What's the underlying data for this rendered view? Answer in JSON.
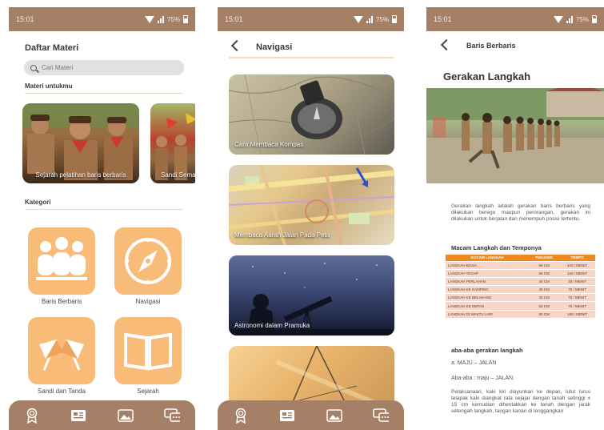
{
  "colors": {
    "statusbar": "#a57f66",
    "accent_tile": "#f8bc78",
    "table_header": "#f1891f",
    "table_row": "#f7d5c7"
  },
  "status": {
    "time": "15:01",
    "battery": "75%"
  },
  "screen1": {
    "title": "Daftar Materi",
    "search_placeholder": "Cari Materi",
    "section_recommended": "Materi untukmu",
    "cards": [
      {
        "label": "Sejarah pelatihan baris berbaris"
      },
      {
        "label": "Sandi Semap"
      }
    ],
    "section_category": "Kategori",
    "categories": [
      {
        "label": "Baris Berbaris",
        "icon": "people-group-icon"
      },
      {
        "label": "Navigasi",
        "icon": "compass-icon"
      },
      {
        "label": "Sandi dan Tanda",
        "icon": "semaphore-flags-icon"
      },
      {
        "label": "Sejarah",
        "icon": "open-book-icon"
      }
    ]
  },
  "screen2": {
    "title": "Navigasi",
    "cards": [
      {
        "label": "Cara Membaca Kompas"
      },
      {
        "label": "Membaca Aarah Jalan Pada Peta"
      },
      {
        "label": "Astronomi dalam Pramuka"
      },
      {
        "label": ""
      }
    ]
  },
  "screen3": {
    "title": "Baris Berbaris",
    "heading": "Gerakan Langkah",
    "intro": "Gerakan langkah adalah gerakan baris berbaris yang dilakukan beregu maupun perorangan, gerakan ini dilakukan untuk berjalan dan menempuh posisi tertentu.",
    "table_title": "Macam Langkah dan Temponya",
    "table": {
      "headers": [
        "MACAM LANGKAH",
        "PANJANG",
        "TEMPO"
      ],
      "rows": [
        [
          "LANGKAH BIASA",
          "65 CM",
          "120 / MENIT"
        ],
        [
          "LANGKAH TEGAP",
          "65 CM",
          "120 / MENIT"
        ],
        [
          "LANGKAH PERLAHAN",
          "40 CM",
          "30 / MENIT"
        ],
        [
          "LANGKAH KE SAMPING",
          "40 CM",
          "70 / MENIT"
        ],
        [
          "LANGKAH KE BELAKANG",
          "40 CM",
          "70 / MENIT"
        ],
        [
          "LANGKAH KE DEPAN",
          "60 CM",
          "70 / MENIT"
        ],
        [
          "LANGKAH DI WAKTU LARI",
          "80 CM",
          "165 / MENIT"
        ]
      ]
    },
    "command_title": "aba-aba gerakan langkah",
    "command_1": "a. MAJU – JALAN",
    "command_2": "Aba-aba : maju – JALAN.",
    "execution": "Pelaksanaan, kaki kiri diayunkan ke depan, lutut lurus telapak kaki diangkat rata sejajar dengan tanah setinggi ± 15 cm kemudian dihentakkan ke tanah dengan jarak setengah langkah, tangan kanan di lenggangkan"
  },
  "bottom_nav": [
    "award-badge-icon",
    "news-card-icon",
    "gallery-image-icon",
    "chat-bubbles-icon"
  ]
}
